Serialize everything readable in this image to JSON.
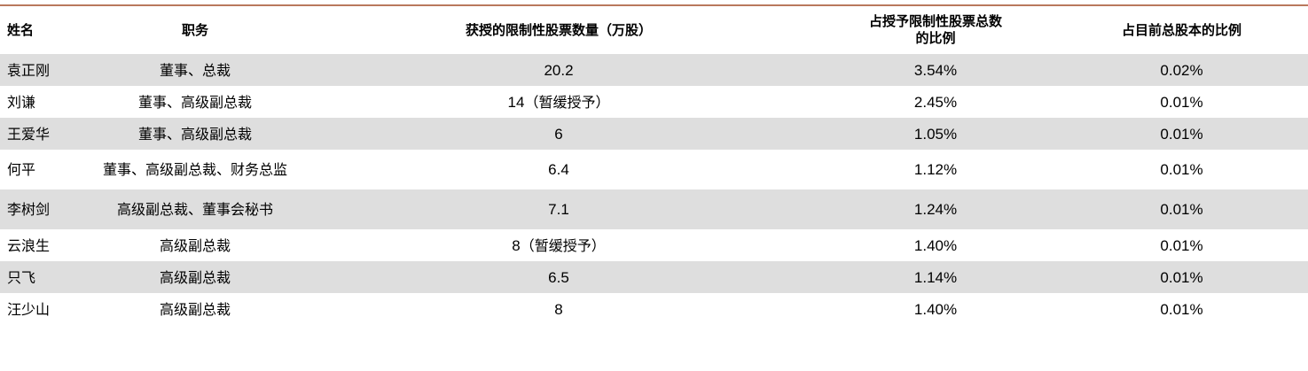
{
  "headers": {
    "name": "姓名",
    "position": "职务",
    "shares": "获授的限制性股票数量（万股）",
    "pct_grant_line1": "占授予限制性股票总数",
    "pct_grant_line2": "的比例",
    "pct_total": "占目前总股本的比例"
  },
  "rows": [
    {
      "name": "袁正刚",
      "position": "董事、总裁",
      "shares": "20.2",
      "shares_note": "",
      "pct_grant": "3.54%",
      "pct_total": "0.02%"
    },
    {
      "name": "刘谦",
      "position": "董事、高级副总裁",
      "shares": "14",
      "shares_note": "（暂缓授予）",
      "pct_grant": "2.45%",
      "pct_total": "0.01%"
    },
    {
      "name": "王爱华",
      "position": "董事、高级副总裁",
      "shares": "6",
      "shares_note": "",
      "pct_grant": "1.05%",
      "pct_total": "0.01%"
    },
    {
      "name": "何平",
      "position": "董事、高级副总裁、财务总监",
      "shares": "6.4",
      "shares_note": "",
      "pct_grant": "1.12%",
      "pct_total": "0.01%"
    },
    {
      "name": "李树剑",
      "position": "高级副总裁、董事会秘书",
      "shares": "7.1",
      "shares_note": "",
      "pct_grant": "1.24%",
      "pct_total": "0.01%"
    },
    {
      "name": "云浪生",
      "position": "高级副总裁",
      "shares": "8",
      "shares_note": "（暂缓授予）",
      "pct_grant": "1.40%",
      "pct_total": "0.01%"
    },
    {
      "name": "只飞",
      "position": "高级副总裁",
      "shares": "6.5",
      "shares_note": "",
      "pct_grant": "1.14%",
      "pct_total": "0.01%"
    },
    {
      "name": "汪少山",
      "position": "高级副总裁",
      "shares": "8",
      "shares_note": "",
      "pct_grant": "1.40%",
      "pct_total": "0.01%"
    }
  ]
}
